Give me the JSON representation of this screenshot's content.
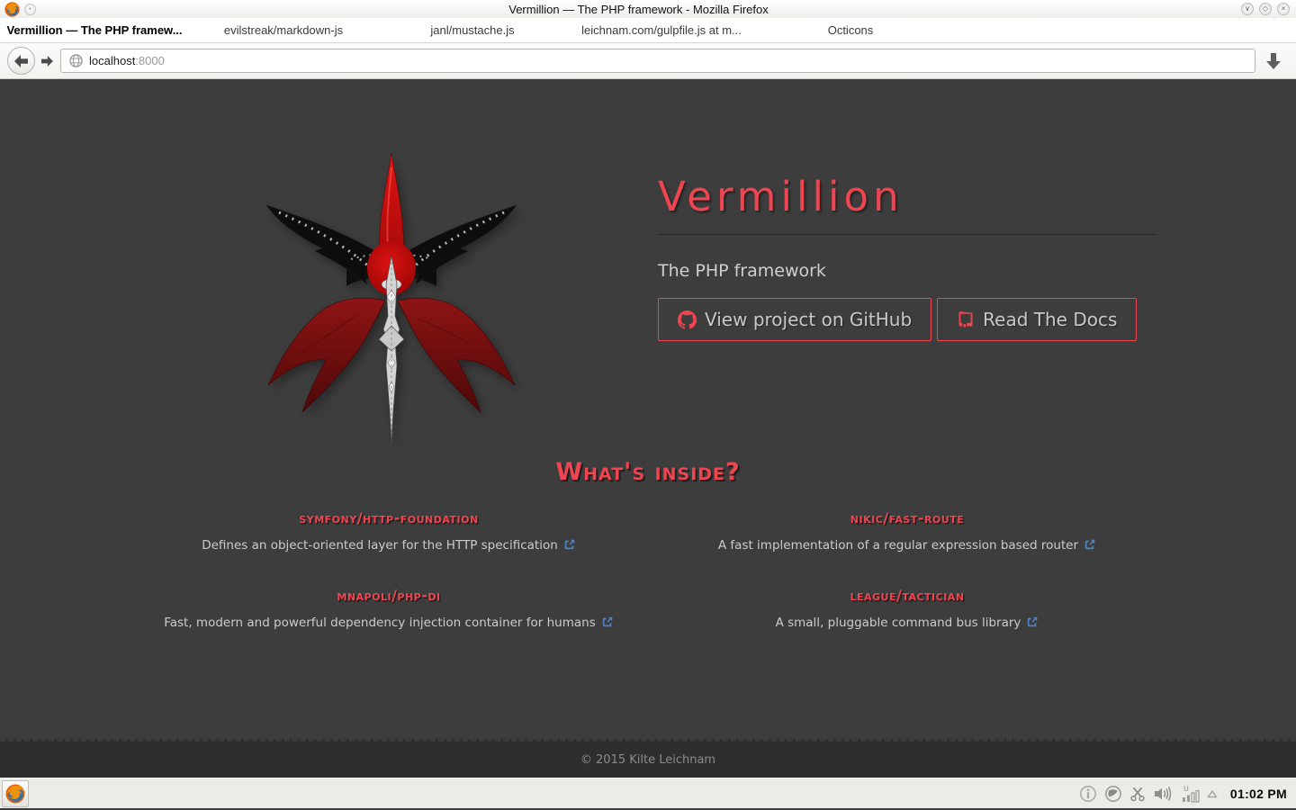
{
  "window": {
    "title": "Vermillion — The PHP framework - Mozilla Firefox",
    "controls": {
      "minimize_glyph": "∨",
      "maximize_glyph": "◇",
      "close_glyph": "×"
    }
  },
  "tabs": [
    {
      "label": "Vermillion — The PHP framew...",
      "active": true
    },
    {
      "label": "evilstreak/markdown-js",
      "active": false
    },
    {
      "label": "janl/mustache.js",
      "active": false
    },
    {
      "label": "leichnam.com/gulpfile.js at m...",
      "active": false
    },
    {
      "label": "Octicons",
      "active": false
    }
  ],
  "navbar": {
    "url_host": "localhost",
    "url_port": ":8000"
  },
  "page": {
    "title": "Vermillion",
    "subtitle": "The PHP framework",
    "github_button": "View project on GitHub",
    "docs_button": "Read The Docs",
    "section_heading": "What's inside?",
    "packages": [
      {
        "name": "symfony/http-foundation",
        "description": "Defines an object-oriented layer for the HTTP specification"
      },
      {
        "name": "nikic/fast-route",
        "description": "A fast implementation of a regular expression based router"
      },
      {
        "name": "mnapoli/php-di",
        "description": "Fast, modern and powerful dependency injection container for humans"
      },
      {
        "name": "league/tactician",
        "description": "A small, pluggable command bus library"
      }
    ],
    "footer": "© 2015 Kilte Leichnam"
  },
  "taskbar": {
    "signal_letter": "U",
    "clock": "01:02 PM"
  },
  "colors": {
    "accent": "#ef4550",
    "link_blue": "#4d84c1",
    "page_bg": "#3d3d3d",
    "footer_bg": "#2e2e2e"
  }
}
